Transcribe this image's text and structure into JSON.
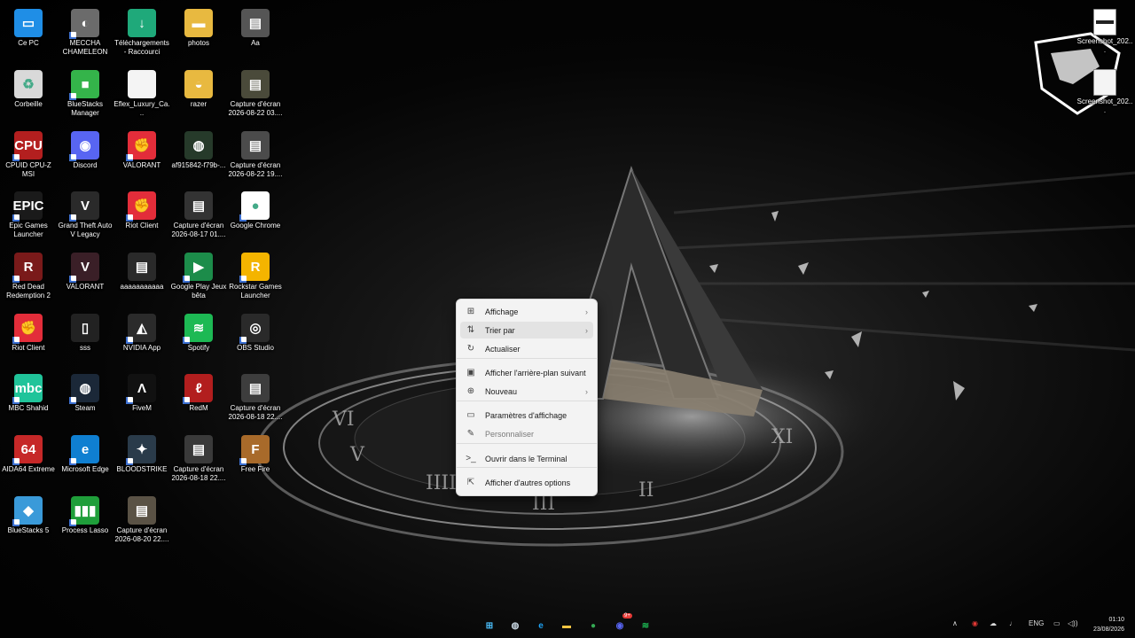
{
  "desktop_icons": [
    {
      "label": "Ce PC",
      "color": "#1f8ee6",
      "glyph": "▭",
      "icon": "monitor-icon"
    },
    {
      "label": "MECCHA CHAMELEON",
      "color": "#6b6b6b",
      "glyph": "◐",
      "icon": "game-icon"
    },
    {
      "label": "Téléchargements - Raccourci",
      "color": "#1fa97a",
      "glyph": "↓",
      "icon": "download-folder-icon"
    },
    {
      "label": "photos",
      "color": "#e8b940",
      "glyph": "▬",
      "icon": "folder-icon"
    },
    {
      "label": "Aa",
      "color": "#555555",
      "glyph": "▤",
      "icon": "image-file-icon"
    },
    {
      "label": "Corbeille",
      "color": "#d9d9d9",
      "glyph": "♻",
      "icon": "recycle-bin-icon"
    },
    {
      "label": "BlueStacks Manager",
      "color": "#34b44a",
      "glyph": "■",
      "icon": "bluestacks-manager-icon"
    },
    {
      "label": "Eflex_Luxury_Ca...",
      "color": "#f4f4f4",
      "glyph": "",
      "icon": "document-file-icon"
    },
    {
      "label": "razer",
      "color": "#e8b940",
      "glyph": "◒",
      "icon": "folder-icon"
    },
    {
      "label": "Capture d'écran 2026-08-22 03....",
      "color": "#4a4a3a",
      "glyph": "▤",
      "icon": "image-file-icon"
    },
    {
      "label": "CPUID CPU-Z MSI",
      "color": "#b31f1f",
      "glyph": "CPU",
      "icon": "cpuz-icon"
    },
    {
      "label": "Discord",
      "color": "#5865f2",
      "glyph": "◉",
      "icon": "discord-icon"
    },
    {
      "label": "VALORANT",
      "color": "#e32d3a",
      "glyph": "✊",
      "icon": "riot-icon"
    },
    {
      "label": "af915842-f79b-...",
      "color": "#263a2a",
      "glyph": "◍",
      "icon": "image-file-icon"
    },
    {
      "label": "Capture d'écran 2026-08-22 19....",
      "color": "#4b4b4b",
      "glyph": "▤",
      "icon": "image-file-icon"
    },
    {
      "label": "Epic Games Launcher",
      "color": "#1a1a1a",
      "glyph": "EPIC",
      "icon": "epic-games-icon"
    },
    {
      "label": "Grand Theft Auto V Legacy",
      "color": "#2a2a2a",
      "glyph": "V",
      "icon": "gta-icon"
    },
    {
      "label": "Riot Client",
      "color": "#e32d3a",
      "glyph": "✊",
      "icon": "riot-icon"
    },
    {
      "label": "Capture d'écran 2026-08-17 01....",
      "color": "#333333",
      "glyph": "▤",
      "icon": "image-file-icon"
    },
    {
      "label": "Google Chrome",
      "color": "#ffffff",
      "glyph": "●",
      "icon": "chrome-icon"
    },
    {
      "label": "Red Dead Redemption 2",
      "color": "#7a1a1a",
      "glyph": "R",
      "icon": "rdr2-icon"
    },
    {
      "label": "VALORANT",
      "color": "#3a1f27",
      "glyph": "V",
      "icon": "valorant-icon"
    },
    {
      "label": "aaaaaaaaaaa",
      "color": "#2a2a2a",
      "glyph": "▤",
      "icon": "image-file-icon"
    },
    {
      "label": "Google Play Jeux bêta",
      "color": "#1c8c4a",
      "glyph": "▶",
      "icon": "google-play-games-icon"
    },
    {
      "label": "Rockstar Games Launcher",
      "color": "#f4b400",
      "glyph": "R",
      "icon": "rockstar-icon"
    },
    {
      "label": "Riot Client",
      "color": "#e32d3a",
      "glyph": "✊",
      "icon": "riot-icon"
    },
    {
      "label": "sss",
      "color": "#222222",
      "glyph": "▯",
      "icon": "image-file-icon"
    },
    {
      "label": "NVIDIA App",
      "color": "#2b2b2b",
      "glyph": "◭",
      "icon": "nvidia-icon"
    },
    {
      "label": "Spotify",
      "color": "#1db954",
      "glyph": "≋",
      "icon": "spotify-icon"
    },
    {
      "label": "OBS Studio",
      "color": "#2a2a2a",
      "glyph": "◎",
      "icon": "obs-icon"
    },
    {
      "label": "MBC Shahid",
      "color": "#20c49a",
      "glyph": "mbc",
      "icon": "shahid-icon"
    },
    {
      "label": "Steam",
      "color": "#1b2838",
      "glyph": "◍",
      "icon": "steam-icon"
    },
    {
      "label": "FiveM",
      "color": "#111111",
      "glyph": "Λ",
      "icon": "fivem-icon"
    },
    {
      "label": "RedM",
      "color": "#b21e1e",
      "glyph": "ℓ",
      "icon": "redm-icon"
    },
    {
      "label": "Capture d'écran 2026-08-18 22....",
      "color": "#3d3d3d",
      "glyph": "▤",
      "icon": "image-file-icon"
    },
    {
      "label": "AIDA64 Extreme",
      "color": "#c62828",
      "glyph": "64",
      "icon": "aida64-icon"
    },
    {
      "label": "Microsoft Edge",
      "color": "#0f7fd1",
      "glyph": "e",
      "icon": "edge-icon"
    },
    {
      "label": "BLOODSTRIKE",
      "color": "#2a3b4a",
      "glyph": "✦",
      "icon": "bloodstrike-icon"
    },
    {
      "label": "Capture d'écran 2026-08-18 22....",
      "color": "#3a3a3a",
      "glyph": "▤",
      "icon": "image-file-icon"
    },
    {
      "label": "Free Fire",
      "color": "#a86a2a",
      "glyph": "F",
      "icon": "free-fire-icon"
    },
    {
      "label": "BlueStacks 5",
      "color": "#3a9ad9",
      "glyph": "◆",
      "icon": "bluestacks-icon"
    },
    {
      "label": "Process Lasso",
      "color": "#1f9e3a",
      "glyph": "▮▮▮",
      "icon": "process-lasso-icon"
    },
    {
      "label": "Capture d'écran 2026-08-20 22....",
      "color": "#5a5245",
      "glyph": "▤",
      "icon": "image-file-icon"
    }
  ],
  "right_files": [
    {
      "label": "Screenshot_202..."
    },
    {
      "label": "Screenshot_202..."
    }
  ],
  "context_menu": {
    "items": [
      {
        "label": "Affichage",
        "icon": "⊞",
        "submenu": true,
        "dim": false,
        "name": "affichage"
      },
      {
        "label": "Trier par",
        "icon": "⇅",
        "submenu": true,
        "dim": false,
        "name": "trier-par"
      },
      {
        "label": "Actualiser",
        "icon": "↻",
        "submenu": false,
        "dim": false,
        "name": "actualiser"
      },
      {
        "label": "Afficher l'arrière-plan suivant",
        "icon": "▣",
        "submenu": false,
        "dim": false,
        "name": "arriere-plan-suivant"
      },
      {
        "label": "Nouveau",
        "icon": "⊕",
        "submenu": true,
        "dim": false,
        "name": "nouveau"
      },
      {
        "label": "Paramètres d'affichage",
        "icon": "▭",
        "submenu": false,
        "dim": false,
        "name": "parametres-affichage"
      },
      {
        "label": "Personnaliser",
        "icon": "✎",
        "submenu": false,
        "dim": true,
        "name": "personnaliser"
      },
      {
        "label": "Ouvrir dans le Terminal",
        "icon": ">_",
        "submenu": false,
        "dim": false,
        "name": "ouvrir-terminal"
      },
      {
        "label": "Afficher d'autres options",
        "icon": "⇱",
        "submenu": false,
        "dim": false,
        "name": "autres-options"
      }
    ]
  },
  "taskbar": {
    "apps": [
      {
        "name": "start",
        "glyph": "⊞",
        "color": "#4cc2ff"
      },
      {
        "name": "steam",
        "glyph": "◍",
        "color": "#c7d5e0"
      },
      {
        "name": "edge",
        "glyph": "e",
        "color": "#1da1f2"
      },
      {
        "name": "file-explorer",
        "glyph": "▬",
        "color": "#f4c542"
      },
      {
        "name": "chrome",
        "glyph": "●",
        "color": "#34a853"
      },
      {
        "name": "discord",
        "glyph": "◉",
        "color": "#5865f2"
      },
      {
        "name": "spotify",
        "glyph": "≋",
        "color": "#1db954"
      }
    ],
    "discord_badge": "9+",
    "language": "ENG",
    "time": "01:10",
    "date": "23/08/2026"
  }
}
